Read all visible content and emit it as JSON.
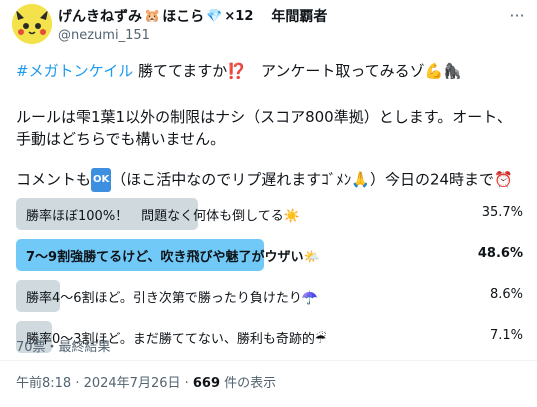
{
  "user": {
    "display_name": "げんきねずみ",
    "emoji1": "🐹",
    "name_part2": "ほこら",
    "emoji2": "💎",
    "count": "×12",
    "title": "年間覇者",
    "handle": "@nezumi_151"
  },
  "tweet": {
    "hashtag": "#メガトンケイル",
    "line1_rest": " 勝ててますか⁉️　アンケート取ってみるゾ💪🦍",
    "paragraph2": "ルールは雫1葉1以外の制限はナシ（スコア800準拠）とします。オート、手動はどちらでも構いません。",
    "line3_start": "コメントも",
    "ok_label": "OK",
    "line3_end": "（ほこ活中なのでリプ遅れますｺﾞﾒﾝ🙏）今日の24時まで⏰"
  },
  "poll": {
    "options": [
      {
        "label": "勝率ほぼ100%！　問題なく何体も倒してる☀️",
        "percent": "35.7%",
        "fraction": 0.357,
        "winner": false
      },
      {
        "label": "7〜9割強勝てるけど、吹き飛びや魅了がウザい🌤️",
        "percent": "48.6%",
        "fraction": 0.486,
        "winner": true
      },
      {
        "label": "勝率4〜6割ほど。引き次第で勝ったり負けたり☂️",
        "percent": "8.6%",
        "fraction": 0.086,
        "winner": false
      },
      {
        "label": "勝率0〜3割ほど。まだ勝ててない、勝利も奇跡的☔",
        "percent": "7.1%",
        "fraction": 0.071,
        "winner": false
      }
    ],
    "summary": "70票・最終結果",
    "colors": {
      "winner": "#71c9f8",
      "other": "#cfd9de"
    }
  },
  "meta": {
    "datetime": "午前8:18 · 2024年7月26日 · ",
    "views": "669",
    "views_label": " 件の表示"
  },
  "icons": {
    "more": "more-horizontal-icon",
    "avatar": "yellow-creature-avatar"
  }
}
